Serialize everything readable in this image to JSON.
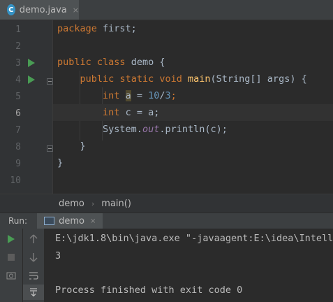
{
  "tab": {
    "icon_letter": "C",
    "label": "demo.java",
    "close": "×"
  },
  "editor": {
    "line_numbers": [
      "1",
      "2",
      "3",
      "4",
      "5",
      "6",
      "7",
      "8",
      "9",
      "10"
    ],
    "lines": [
      {
        "pkg_kw": "package",
        "pkg_name": " first;"
      },
      {},
      {
        "kw1": "public",
        "kw2": "class",
        "name": " demo {"
      },
      {
        "kw1": "public",
        "kw2": "static",
        "kw3": "void",
        "fn": "main",
        "rest": "(String[] args) {"
      },
      {
        "type": "int",
        "var": "a",
        "eq": " = ",
        "num1": "10",
        "slash": "/",
        "num2": "3",
        "end": ";"
      },
      {
        "type": "int",
        "var": "c",
        "rest": " = a;"
      },
      {
        "obj": "System.",
        "field": "out",
        "call": ".println(c);"
      },
      {
        "text": "}"
      },
      {
        "text": "}"
      },
      {}
    ]
  },
  "breadcrumb": {
    "class": "demo",
    "separator": "›",
    "method": "main()"
  },
  "run_panel": {
    "title": "Run:",
    "tab_label": "demo",
    "tab_close": "×"
  },
  "console": {
    "lines": [
      "E:\\jdk1.8\\bin\\java.exe \"-javaagent:E:\\idea\\Intelli",
      "3",
      "",
      "Process finished with exit code 0"
    ]
  },
  "toolbar_icons": [
    "run-icon",
    "up-arrow-icon",
    "stop-icon",
    "down-arrow-icon",
    "wrap-icon",
    "scroll-end-icon"
  ]
}
